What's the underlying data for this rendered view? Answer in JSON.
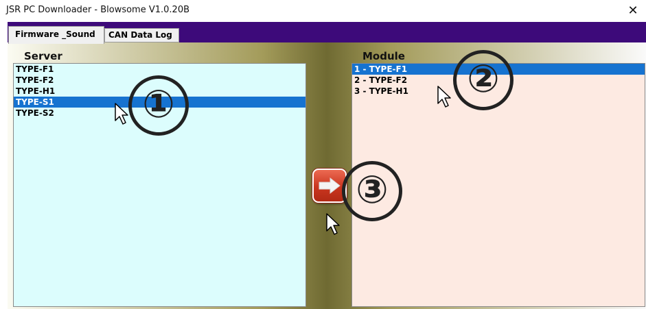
{
  "window": {
    "title": "JSR PC Downloader - Blowsome V1.0.20B",
    "close_glyph": "✕"
  },
  "tabs": [
    {
      "label": "Firmware _Sound",
      "active": true
    },
    {
      "label": "CAN Data Log",
      "active": false
    }
  ],
  "server": {
    "label": "Server",
    "items": [
      "TYPE-F1",
      "TYPE-F2",
      "TYPE-H1",
      "TYPE-S1",
      "TYPE-S2"
    ],
    "selected": "TYPE-S1"
  },
  "module": {
    "label": "Module",
    "items": [
      "1 - TYPE-F1",
      "2 - TYPE-F2",
      "3 - TYPE-H1"
    ],
    "selected": "1 - TYPE-F1"
  },
  "transfer_button": {
    "icon": "right-arrow-icon"
  },
  "annotations": [
    "①",
    "②",
    "③"
  ],
  "colors": {
    "tab_strip": "#3d0a7a",
    "server_list_bg": "#dcfdfd",
    "module_list_bg": "#fdeae2",
    "selection": "#1673d0",
    "transfer_button": "#c9351f"
  }
}
